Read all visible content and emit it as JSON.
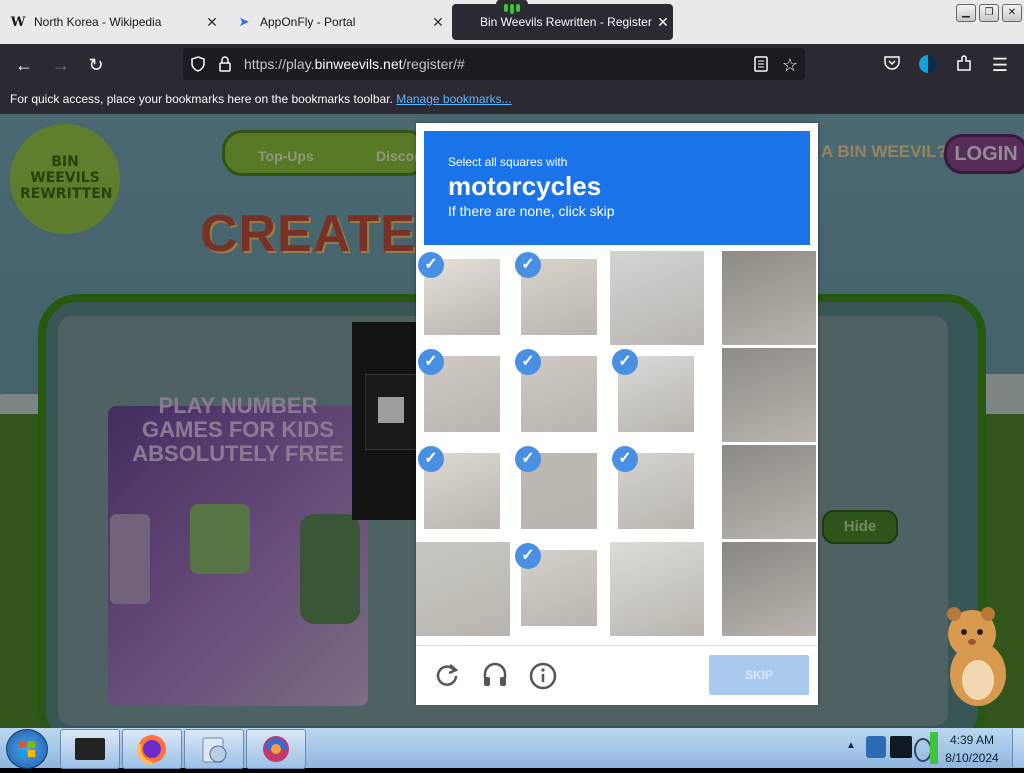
{
  "browser": {
    "tabs": [
      {
        "favicon": "W",
        "title": "North Korea - Wikipedia",
        "close": "✕"
      },
      {
        "favicon": "➤",
        "title": "AppOnFly - Portal",
        "close": "✕"
      },
      {
        "favicon": "",
        "title": "Bin Weevils Rewritten - Register",
        "close": "✕"
      }
    ],
    "window_buttons": [
      "▁",
      "❐",
      "✕"
    ],
    "url_prefix": "https://play.",
    "url_domain": "binweevils.net",
    "url_path": "/register/#",
    "bookmarks_message": "For quick access, place your bookmarks here on the bookmarks toolbar.",
    "bookmarks_link": "Manage bookmarks..."
  },
  "page": {
    "nav_topups": "Top-Ups",
    "nav_discord": "Discord",
    "login_prompt": "A BIN WEEVIL?",
    "login_button": "LOGIN",
    "heading": "CREATE Y",
    "ad_line1": "PLAY NUMBER",
    "ad_line2": "GAMES FOR KIDS",
    "ad_line3": "ABSOLUTELY FREE",
    "hide_button": "Hide",
    "logo_text": "BIN WEEVILS REWRITTEN"
  },
  "captcha": {
    "prompt_small": "Select all squares with",
    "prompt_target": "motorcycles",
    "prompt_hint": "If there are none, click skip",
    "skip_label": "SKIP",
    "selected_tiles": [
      0,
      1,
      4,
      5,
      6,
      8,
      9,
      10,
      13
    ]
  },
  "taskbar": {
    "time": "4:39 AM",
    "date": "8/10/2024"
  }
}
